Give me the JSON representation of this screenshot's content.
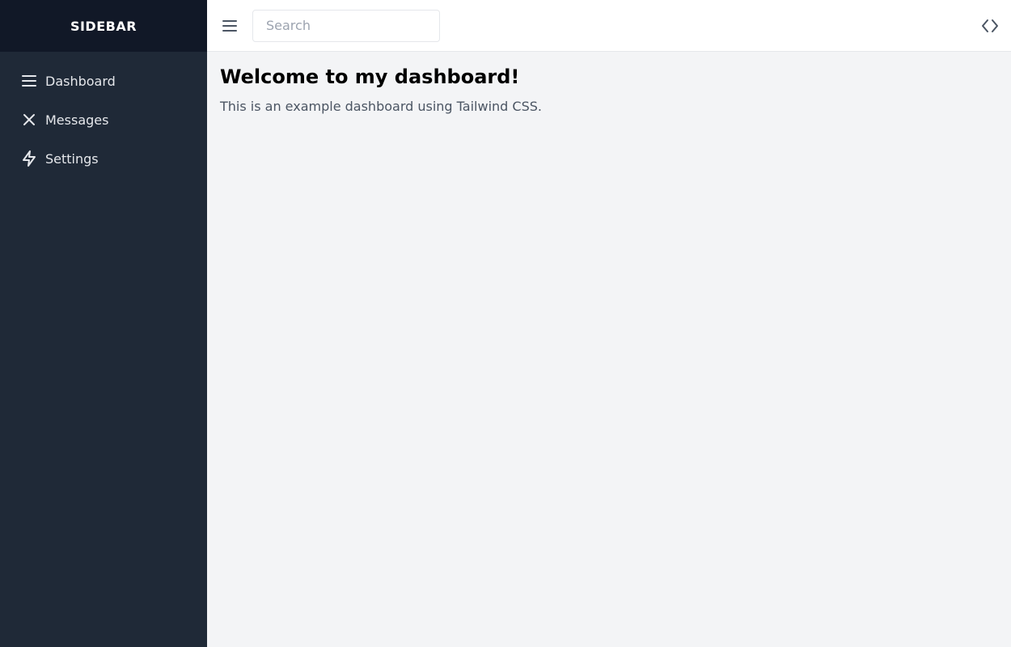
{
  "sidebar": {
    "title": "SIDEBAR",
    "items": [
      {
        "label": "Dashboard",
        "icon": "menu-icon"
      },
      {
        "label": "Messages",
        "icon": "close-icon"
      },
      {
        "label": "Settings",
        "icon": "lightning-icon"
      }
    ]
  },
  "topbar": {
    "menu_icon": "hamburger-menu-icon",
    "search_placeholder": "Search",
    "search_value": "",
    "code_icon": "code-icon"
  },
  "main": {
    "title": "Welcome to my dashboard!",
    "subtitle": "This is an example dashboard using Tailwind CSS."
  },
  "colors": {
    "sidebar_bg": "#1f2937",
    "sidebar_header_bg": "#111827",
    "main_bg": "#f3f4f6",
    "topbar_bg": "#ffffff"
  }
}
